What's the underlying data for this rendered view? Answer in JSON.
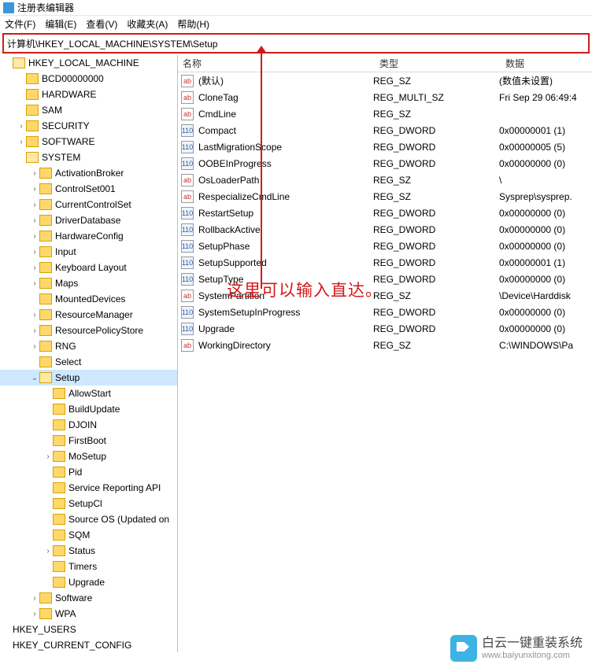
{
  "window": {
    "title": "注册表编辑器"
  },
  "menu": [
    "文件(F)",
    "编辑(E)",
    "查看(V)",
    "收藏夹(A)",
    "帮助(H)"
  ],
  "address": "计算机\\HKEY_LOCAL_MACHINE\\SYSTEM\\Setup",
  "annotation": "这里可以输入直达。",
  "columns": {
    "name": "名称",
    "type": "类型",
    "data": "数据"
  },
  "tree": [
    {
      "d": 0,
      "t": "",
      "label": "HKEY_LOCAL_MACHINE",
      "open": true,
      "f": true
    },
    {
      "d": 1,
      "t": "",
      "label": "BCD00000000",
      "f": true
    },
    {
      "d": 1,
      "t": "",
      "label": "HARDWARE",
      "f": true
    },
    {
      "d": 1,
      "t": "",
      "label": "SAM",
      "f": true
    },
    {
      "d": 1,
      "t": ">",
      "label": "SECURITY",
      "f": true
    },
    {
      "d": 1,
      "t": ">",
      "label": "SOFTWARE",
      "f": true
    },
    {
      "d": 1,
      "t": "",
      "label": "SYSTEM",
      "open": true,
      "f": true
    },
    {
      "d": 2,
      "t": ">",
      "label": "ActivationBroker",
      "f": true
    },
    {
      "d": 2,
      "t": ">",
      "label": "ControlSet001",
      "f": true
    },
    {
      "d": 2,
      "t": ">",
      "label": "CurrentControlSet",
      "f": true
    },
    {
      "d": 2,
      "t": ">",
      "label": "DriverDatabase",
      "f": true
    },
    {
      "d": 2,
      "t": ">",
      "label": "HardwareConfig",
      "f": true
    },
    {
      "d": 2,
      "t": ">",
      "label": "Input",
      "f": true
    },
    {
      "d": 2,
      "t": ">",
      "label": "Keyboard Layout",
      "f": true
    },
    {
      "d": 2,
      "t": ">",
      "label": "Maps",
      "f": true
    },
    {
      "d": 2,
      "t": "",
      "label": "MountedDevices",
      "f": true
    },
    {
      "d": 2,
      "t": ">",
      "label": "ResourceManager",
      "f": true
    },
    {
      "d": 2,
      "t": ">",
      "label": "ResourcePolicyStore",
      "f": true
    },
    {
      "d": 2,
      "t": ">",
      "label": "RNG",
      "f": true
    },
    {
      "d": 2,
      "t": "",
      "label": "Select",
      "f": true
    },
    {
      "d": 2,
      "t": "v",
      "label": "Setup",
      "f": true,
      "sel": true,
      "open": true
    },
    {
      "d": 3,
      "t": "",
      "label": "AllowStart",
      "f": true
    },
    {
      "d": 3,
      "t": "",
      "label": "BuildUpdate",
      "f": true
    },
    {
      "d": 3,
      "t": "",
      "label": "DJOIN",
      "f": true
    },
    {
      "d": 3,
      "t": "",
      "label": "FirstBoot",
      "f": true
    },
    {
      "d": 3,
      "t": ">",
      "label": "MoSetup",
      "f": true
    },
    {
      "d": 3,
      "t": "",
      "label": "Pid",
      "f": true
    },
    {
      "d": 3,
      "t": "",
      "label": "Service Reporting API",
      "f": true
    },
    {
      "d": 3,
      "t": "",
      "label": "SetupCl",
      "f": true
    },
    {
      "d": 3,
      "t": "",
      "label": "Source OS (Updated on",
      "f": true
    },
    {
      "d": 3,
      "t": "",
      "label": "SQM",
      "f": true
    },
    {
      "d": 3,
      "t": ">",
      "label": "Status",
      "f": true
    },
    {
      "d": 3,
      "t": "",
      "label": "Timers",
      "f": true
    },
    {
      "d": 3,
      "t": "",
      "label": "Upgrade",
      "f": true
    },
    {
      "d": 2,
      "t": ">",
      "label": "Software",
      "f": true
    },
    {
      "d": 2,
      "t": ">",
      "label": "WPA",
      "f": true
    },
    {
      "d": 0,
      "t": "",
      "label": "HKEY_USERS",
      "f": false
    },
    {
      "d": 0,
      "t": "",
      "label": "HKEY_CURRENT_CONFIG",
      "f": false
    }
  ],
  "values": [
    {
      "ic": "sz",
      "name": "(默认)",
      "type": "REG_SZ",
      "data": "(数值未设置)"
    },
    {
      "ic": "sz",
      "name": "CloneTag",
      "type": "REG_MULTI_SZ",
      "data": "Fri Sep 29 06:49:4"
    },
    {
      "ic": "sz",
      "name": "CmdLine",
      "type": "REG_SZ",
      "data": ""
    },
    {
      "ic": "dw",
      "name": "Compact",
      "type": "REG_DWORD",
      "data": "0x00000001 (1)"
    },
    {
      "ic": "dw",
      "name": "LastMigrationScope",
      "type": "REG_DWORD",
      "data": "0x00000005 (5)"
    },
    {
      "ic": "dw",
      "name": "OOBEInProgress",
      "type": "REG_DWORD",
      "data": "0x00000000 (0)"
    },
    {
      "ic": "sz",
      "name": "OsLoaderPath",
      "type": "REG_SZ",
      "data": "\\"
    },
    {
      "ic": "sz",
      "name": "RespecializeCmdLine",
      "type": "REG_SZ",
      "data": "Sysprep\\sysprep."
    },
    {
      "ic": "dw",
      "name": "RestartSetup",
      "type": "REG_DWORD",
      "data": "0x00000000 (0)"
    },
    {
      "ic": "dw",
      "name": "RollbackActive",
      "type": "REG_DWORD",
      "data": "0x00000000 (0)"
    },
    {
      "ic": "dw",
      "name": "SetupPhase",
      "type": "REG_DWORD",
      "data": "0x00000000 (0)"
    },
    {
      "ic": "dw",
      "name": "SetupSupported",
      "type": "REG_DWORD",
      "data": "0x00000001 (1)"
    },
    {
      "ic": "dw",
      "name": "SetupType",
      "type": "REG_DWORD",
      "data": "0x00000000 (0)"
    },
    {
      "ic": "sz",
      "name": "SystemPartition",
      "type": "REG_SZ",
      "data": "\\Device\\Harddisk"
    },
    {
      "ic": "dw",
      "name": "SystemSetupInProgress",
      "type": "REG_DWORD",
      "data": "0x00000000 (0)"
    },
    {
      "ic": "dw",
      "name": "Upgrade",
      "type": "REG_DWORD",
      "data": "0x00000000 (0)"
    },
    {
      "ic": "sz",
      "name": "WorkingDirectory",
      "type": "REG_SZ",
      "data": "C:\\WINDOWS\\Pa"
    }
  ],
  "watermark": {
    "text": "白云一键重装系统",
    "url": "www.baiyunxitong.com"
  }
}
